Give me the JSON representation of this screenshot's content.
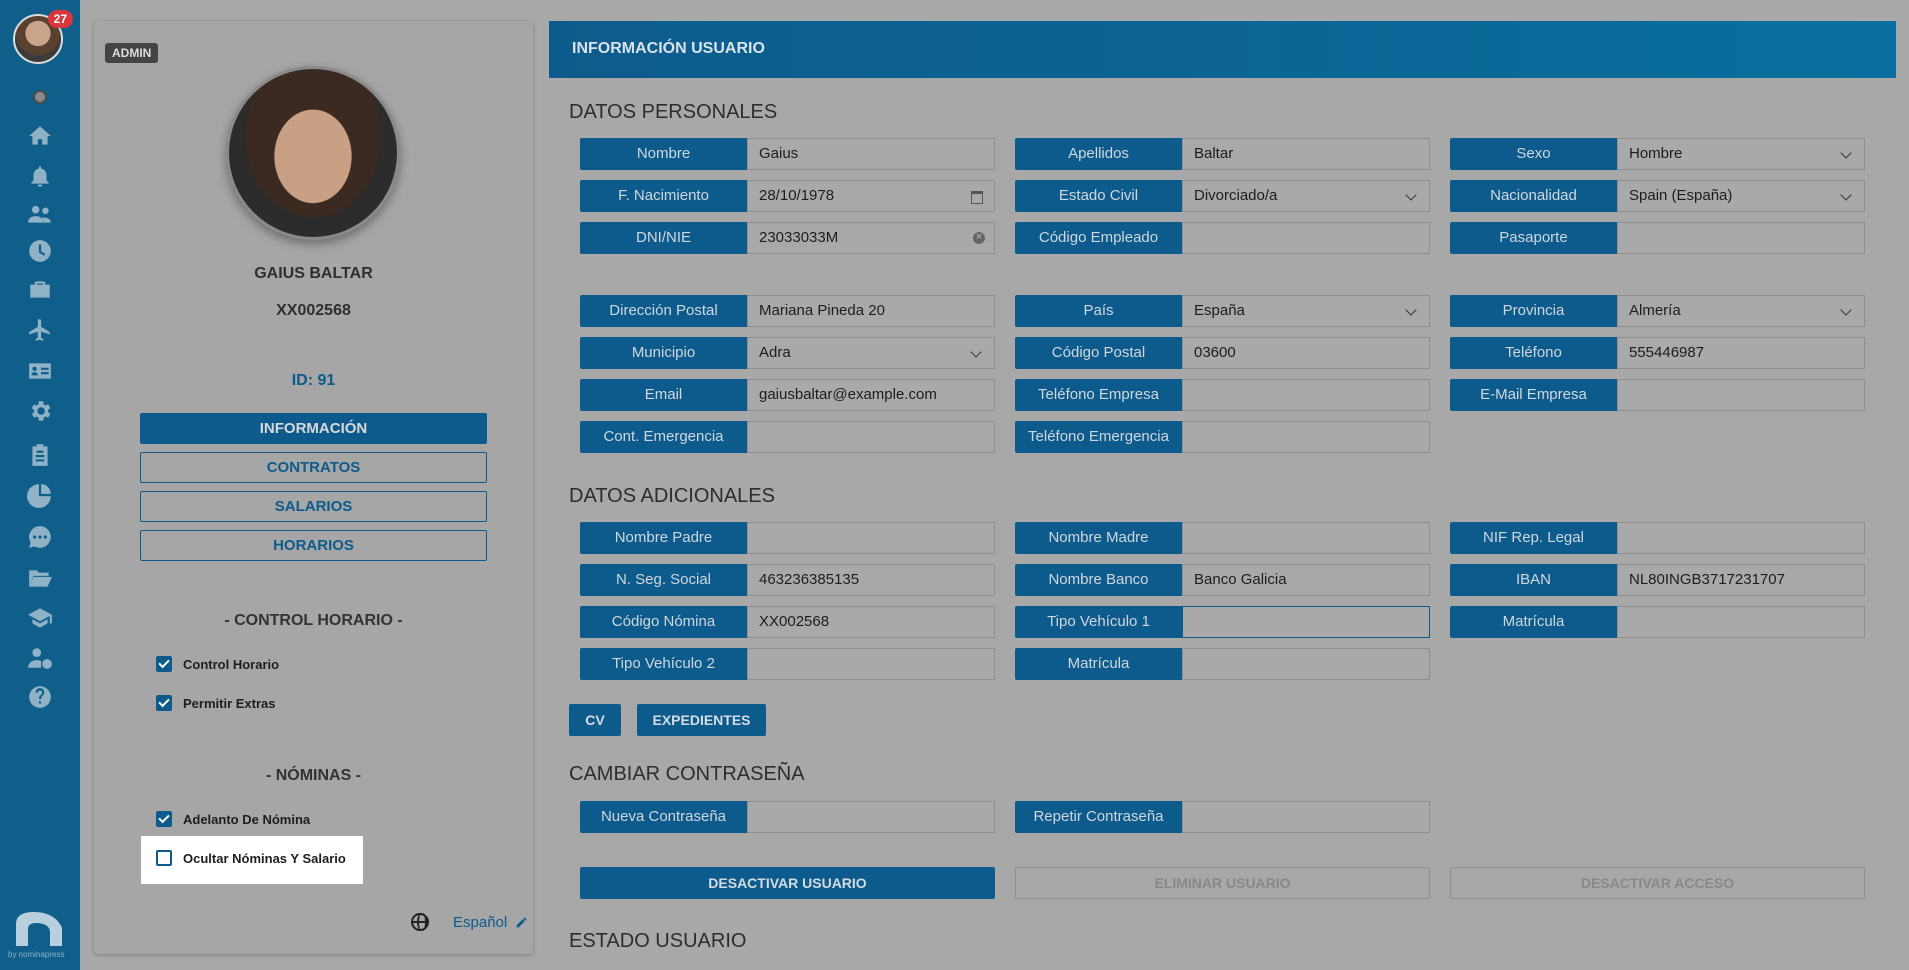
{
  "rail": {
    "notifications": "27",
    "icons": [
      "home-icon",
      "bell-icon",
      "users-icon",
      "clock-icon",
      "briefcase-icon",
      "plane-icon",
      "id-card-icon",
      "gear-icon",
      "clipboard-icon",
      "pie-chart-icon",
      "chat-icon",
      "folder-icon",
      "graduation-cap-icon",
      "user-money-icon",
      "help-icon"
    ],
    "brand_by": "by nominapress"
  },
  "profile": {
    "role_badge": "ADMIN",
    "name": "GAIUS BALTAR",
    "code": "XX002568",
    "id_label": "ID: 91",
    "nav": [
      "INFORMACIÓN",
      "CONTRATOS",
      "SALARIOS",
      "HORARIOS"
    ],
    "control_heading": "- CONTROL HORARIO -",
    "control_checks": [
      {
        "label": "Control Horario",
        "checked": true
      },
      {
        "label": "Permitir Extras",
        "checked": true
      }
    ],
    "payroll_heading": "- NÓMINAS -",
    "payroll_checks": [
      {
        "label": "Adelanto De Nómina",
        "checked": true
      },
      {
        "label": "Ocultar Nóminas Y Salario",
        "checked": false
      }
    ],
    "language": "Español"
  },
  "main": {
    "header": "INFORMACIÓN USUARIO",
    "personal_title": "DATOS PERSONALES",
    "personal": [
      {
        "label": "Nombre",
        "value": "Gaius"
      },
      {
        "label": "Apellidos",
        "value": "Baltar"
      },
      {
        "label": "Sexo",
        "value": "Hombre"
      },
      {
        "label": "F. Nacimiento",
        "value": "28/10/1978"
      },
      {
        "label": "Estado Civil",
        "value": "Divorciado/a"
      },
      {
        "label": "Nacionalidad",
        "value": "Spain (España)"
      },
      {
        "label": "DNI/NIE",
        "value": "23033033M"
      },
      {
        "label": "Código Empleado",
        "value": ""
      },
      {
        "label": "Pasaporte",
        "value": ""
      },
      {
        "label": "Dirección Postal",
        "value": "Mariana Pineda 20"
      },
      {
        "label": "País",
        "value": "España"
      },
      {
        "label": "Provincia",
        "value": "Almería"
      },
      {
        "label": "Municipio",
        "value": "Adra"
      },
      {
        "label": "Código Postal",
        "value": "03600"
      },
      {
        "label": "Teléfono",
        "value": "555446987"
      },
      {
        "label": "Email",
        "value": "gaiusbaltar@example.com"
      },
      {
        "label": "Teléfono Empresa",
        "value": ""
      },
      {
        "label": "E-Mail Empresa",
        "value": ""
      },
      {
        "label": "Cont. Emergencia",
        "value": ""
      },
      {
        "label": "Teléfono Emergencia",
        "value": ""
      }
    ],
    "extra_title": "DATOS ADICIONALES",
    "extra": [
      {
        "label": "Nombre Padre",
        "value": ""
      },
      {
        "label": "Nombre Madre",
        "value": ""
      },
      {
        "label": "NIF Rep. Legal",
        "value": ""
      },
      {
        "label": "N. Seg. Social",
        "value": "463236385135"
      },
      {
        "label": "Nombre Banco",
        "value": "Banco Galicia"
      },
      {
        "label": "IBAN",
        "value": "NL80INGB3717231707"
      },
      {
        "label": "Código Nómina",
        "value": "XX002568"
      },
      {
        "label": "Tipo Vehículo 1",
        "value": ""
      },
      {
        "label": "Matrícula",
        "value": ""
      },
      {
        "label": "Tipo Vehículo 2",
        "value": ""
      },
      {
        "label": "Matrícula",
        "value": ""
      }
    ],
    "doc_buttons": [
      "CV",
      "EXPEDIENTES"
    ],
    "password_title": "CAMBIAR CONTRASEÑA",
    "password": [
      {
        "label": "Nueva Contraseña",
        "value": ""
      },
      {
        "label": "Repetir Contraseña",
        "value": ""
      }
    ],
    "actions": [
      "DESACTIVAR USUARIO",
      "ELIMINAR USUARIO",
      "DESACTIVAR ACCESO"
    ],
    "status_title": "ESTADO USUARIO"
  }
}
